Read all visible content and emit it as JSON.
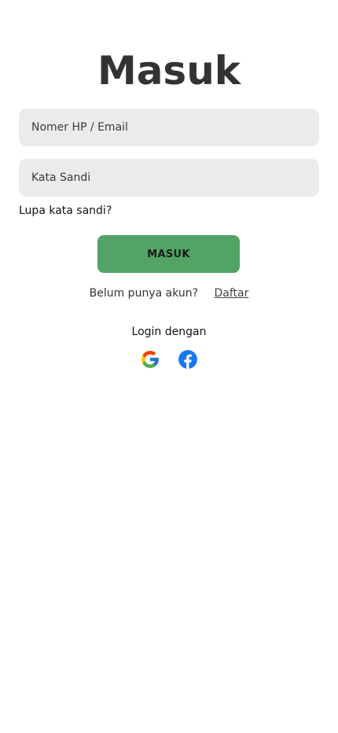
{
  "page": {
    "title": "Masuk"
  },
  "form": {
    "phone_email_placeholder": "Nomer HP / Email",
    "password_placeholder": "Kata Sandi",
    "forgot_label": "Lupa kata sandi?",
    "submit_label": "MASUK"
  },
  "register": {
    "prompt": "Belum punya akun?",
    "link_label": "Daftar"
  },
  "social": {
    "label": "Login dengan",
    "providers": [
      {
        "name": "google",
        "icon": "google-icon"
      },
      {
        "name": "facebook",
        "icon": "facebook-icon",
        "color": "#1877f2"
      }
    ]
  },
  "colors": {
    "primary_button": "#51a366",
    "input_background": "#ebebeb",
    "title_text": "#333333"
  }
}
